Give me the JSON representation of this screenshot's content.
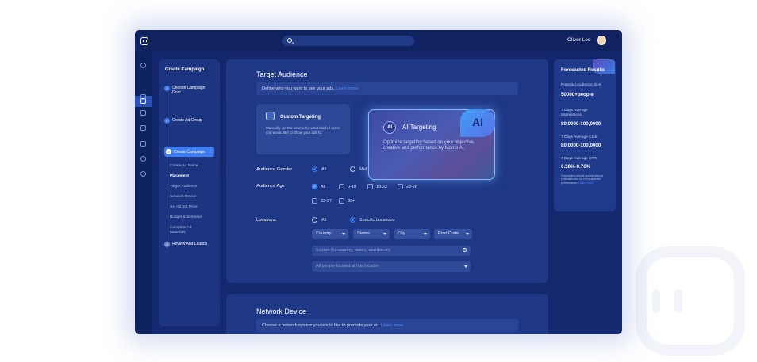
{
  "header": {
    "user_name": "Oliver Lee"
  },
  "steps": {
    "title": "Create Campaign",
    "completed": [
      "Choose Campaign Goal",
      "Create Ad Group"
    ],
    "active": {
      "num": "3",
      "label": "Create Campaign"
    },
    "substeps": [
      "Create Ad Name",
      "Placement",
      "Target Audience",
      "Network Device",
      "Set Ad Bid Price",
      "Budget & Schedule",
      "Complete Ad Materials"
    ],
    "final": {
      "num": "4",
      "label": "Review And Launch"
    }
  },
  "target": {
    "title": "Target Audience",
    "desc": "Define who you want to see your ads.",
    "link": "Learn more",
    "custom": {
      "title": "Custom Targeting",
      "desc": "Manually set the criteria for what kind of users you would like to show your ads to."
    },
    "ai": {
      "badge": "AI",
      "title": "AI Targeting",
      "desc": "Optimize targeting based on your objective, creative and performance by Momo AI.",
      "big": "AI"
    },
    "gender": {
      "label": "Audience Gender",
      "opts": [
        "All",
        "Mal"
      ]
    },
    "age": {
      "label": "Audience Age",
      "opts": [
        "All",
        "0-18",
        "19-22",
        "23-26",
        "23-27",
        "33+"
      ]
    },
    "locations": {
      "label": "Locations",
      "opts": [
        "All",
        "Specific Locations"
      ],
      "dropdowns": [
        "Country",
        "States",
        "City",
        "Post Code"
      ],
      "search_placeholder": "Search the country, states, and the city",
      "people_select": "All people located at this location"
    }
  },
  "network": {
    "title": "Network Device",
    "desc": "Choose a network system you would like to promote your ad.",
    "link": "Learn more"
  },
  "forecast": {
    "title": "Forecasted Results",
    "items": [
      {
        "label": "Potential Audience Size",
        "value": "50000+people"
      },
      {
        "label": "7 Days Average Impressions",
        "value": "80,0000-100,0000"
      },
      {
        "label": "7 Days Average Click",
        "value": "80,0000-100,0000"
      },
      {
        "label": "7 Days Average CTR",
        "value": "0.50%-0.76%"
      }
    ],
    "note": "Forecasted results are directional estimates and do not guarantee performance.",
    "note_link": "Learn more"
  },
  "colors": {
    "accent": "#3e7ef2",
    "bg": "#13266c",
    "panel": "#1e3886"
  }
}
